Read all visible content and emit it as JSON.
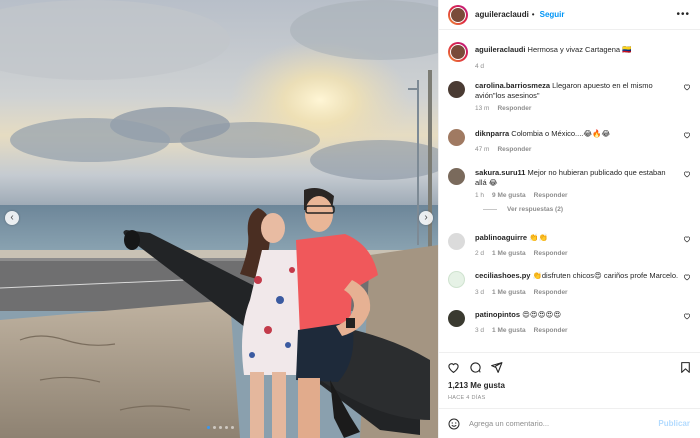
{
  "post": {
    "username": "aguileraclaudi",
    "follow_label": "Seguir",
    "caption_text": "Hermosa y vivaz Cartagena 🇨🇴",
    "caption_time": "4 d"
  },
  "comments": [
    {
      "user": "carolina.barriosmeza",
      "text": "Llegaron apuesto en el mismo avión\"los asesinos\"",
      "time": "13 m",
      "likes": "",
      "reply": "Responder",
      "avatar_color": "#4a3b33"
    },
    {
      "user": "diknparra",
      "text": "Colombia o México....😂🔥😂",
      "time": "47 m",
      "likes": "",
      "reply": "Responder",
      "avatar_color": "#a07a62"
    },
    {
      "user": "sakura.suru11",
      "text": "Mejor no hubieran publicado que estaban allá 😂",
      "time": "1 h",
      "likes": "9 Me gusta",
      "reply": "Responder",
      "avatar_color": "#7a6a5c",
      "view_replies": "Ver respuestas (2)"
    },
    {
      "user": "pablinoaguirre",
      "text": "👏👏",
      "time": "2 d",
      "likes": "1 Me gusta",
      "reply": "Responder",
      "avatar_color": "#dbdbdb"
    },
    {
      "user": "ceciliashoes.py",
      "text": "👏disfruten chicos😍 cariños profe Marcelo.",
      "time": "3 d",
      "likes": "1 Me gusta",
      "reply": "Responder",
      "avatar_color": "#e6f2e6"
    },
    {
      "user": "patinopintos",
      "text": "😍😍😍😍😍",
      "time": "3 d",
      "likes": "1 Me gusta",
      "reply": "Responder",
      "avatar_color": "#3a3a30"
    }
  ],
  "stats": {
    "likes": "1,213 Me gusta",
    "posted_ago": "HACE 4 DÍAS"
  },
  "composer": {
    "placeholder": "Agrega un comentario...",
    "publish_label": "Publicar"
  },
  "icons": [
    "heart-icon",
    "comment-icon",
    "share-icon",
    "bookmark-icon",
    "emoji-icon",
    "more-options-icon",
    "chevron-left-icon",
    "chevron-right-icon"
  ],
  "colors": {
    "link_blue": "#0095f6",
    "publish_disabled": "#b3dbff",
    "meta_gray": "#8e8e8e"
  }
}
